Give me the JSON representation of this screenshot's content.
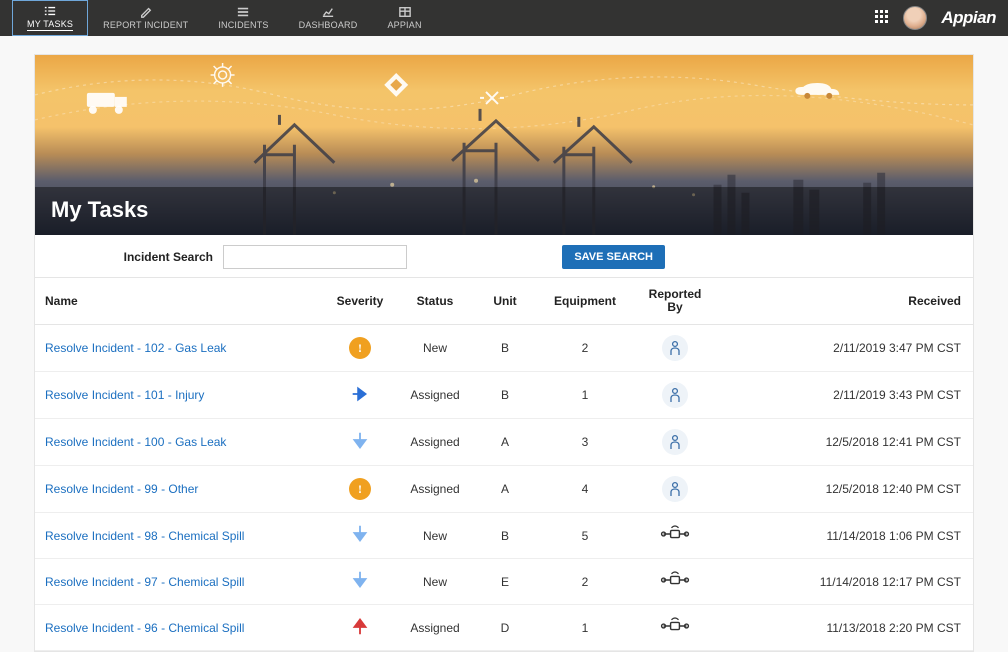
{
  "topnav": {
    "items": [
      {
        "icon": "list-check",
        "label": "MY TASKS",
        "active": true
      },
      {
        "icon": "pencil",
        "label": "REPORT INCIDENT",
        "active": false
      },
      {
        "icon": "list",
        "label": "INCIDENTS",
        "active": false
      },
      {
        "icon": "chart",
        "label": "DASHBOARD",
        "active": false
      },
      {
        "icon": "window",
        "label": "APPIAN",
        "active": false
      }
    ],
    "brand": "Appian"
  },
  "hero": {
    "title": "My Tasks"
  },
  "search": {
    "label": "Incident Search",
    "value": "",
    "save_label": "SAVE SEARCH"
  },
  "table": {
    "headers": {
      "name": "Name",
      "severity": "Severity",
      "status": "Status",
      "unit": "Unit",
      "equipment": "Equipment",
      "reported_by": "Reported By",
      "received": "Received"
    },
    "rows": [
      {
        "name": "Resolve Incident - 102 - Gas Leak",
        "severity": "high",
        "status": "New",
        "unit": "B",
        "equipment": "2",
        "reported_by": "person",
        "received": "2/11/2019 3:47 PM CST"
      },
      {
        "name": "Resolve Incident - 101 - Injury",
        "severity": "right",
        "status": "Assigned",
        "unit": "B",
        "equipment": "1",
        "reported_by": "person",
        "received": "2/11/2019 3:43 PM CST"
      },
      {
        "name": "Resolve Incident - 100 - Gas Leak",
        "severity": "down",
        "status": "Assigned",
        "unit": "A",
        "equipment": "3",
        "reported_by": "person",
        "received": "12/5/2018 12:41 PM CST"
      },
      {
        "name": "Resolve Incident - 99 - Other",
        "severity": "high",
        "status": "Assigned",
        "unit": "A",
        "equipment": "4",
        "reported_by": "person",
        "received": "12/5/2018 12:40 PM CST"
      },
      {
        "name": "Resolve Incident - 98 - Chemical Spill",
        "severity": "down",
        "status": "New",
        "unit": "B",
        "equipment": "5",
        "reported_by": "sensor",
        "received": "11/14/2018 1:06 PM CST"
      },
      {
        "name": "Resolve Incident - 97 - Chemical Spill",
        "severity": "down",
        "status": "New",
        "unit": "E",
        "equipment": "2",
        "reported_by": "sensor",
        "received": "11/14/2018 12:17 PM CST"
      },
      {
        "name": "Resolve Incident - 96 - Chemical Spill",
        "severity": "up-red",
        "status": "Assigned",
        "unit": "D",
        "equipment": "1",
        "reported_by": "sensor",
        "received": "11/13/2018 2:20 PM CST"
      }
    ]
  }
}
